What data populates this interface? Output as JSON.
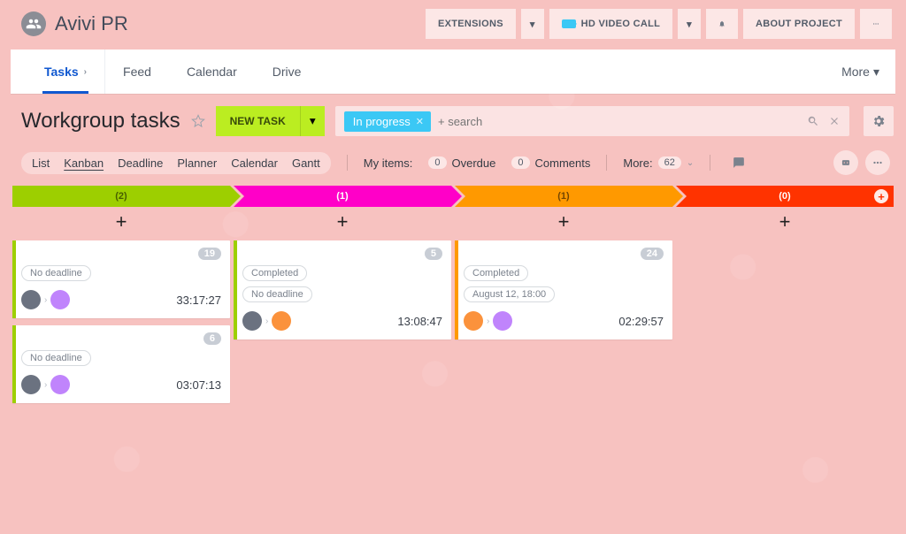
{
  "team_name": "Avivi PR",
  "top_actions": {
    "extensions": "EXTENSIONS",
    "video_call": "HD VIDEO CALL",
    "about": "ABOUT PROJECT"
  },
  "tabs": {
    "tasks": "Tasks",
    "feed": "Feed",
    "calendar": "Calendar",
    "drive": "Drive",
    "more": "More"
  },
  "page_title": "Workgroup tasks",
  "new_task": "NEW TASK",
  "search": {
    "chip": "In progress",
    "placeholder": "+ search"
  },
  "views": {
    "list": "List",
    "kanban": "Kanban",
    "deadline": "Deadline",
    "planner": "Planner",
    "calendar": "Calendar",
    "gantt": "Gantt"
  },
  "filters": {
    "my_items": "My items:",
    "overdue": {
      "count": "0",
      "label": "Overdue"
    },
    "comments": {
      "count": "0",
      "label": "Comments"
    },
    "more": {
      "label": "More:",
      "count": "62"
    }
  },
  "columns": [
    {
      "count": "(2)"
    },
    {
      "count": "(1)"
    },
    {
      "count": "(1)"
    },
    {
      "count": "(0)"
    }
  ],
  "cards": {
    "c1": {
      "num": "19",
      "deadline": "No deadline",
      "timer": "33:17:27"
    },
    "c2": {
      "num": "6",
      "deadline": "No deadline",
      "timer": "03:07:13"
    },
    "c3": {
      "num": "5",
      "completed": "Completed",
      "deadline": "No deadline",
      "timer": "13:08:47"
    },
    "c4": {
      "num": "24",
      "completed": "Completed",
      "deadline": "August 12, 18:00",
      "timer": "02:29:57"
    }
  }
}
